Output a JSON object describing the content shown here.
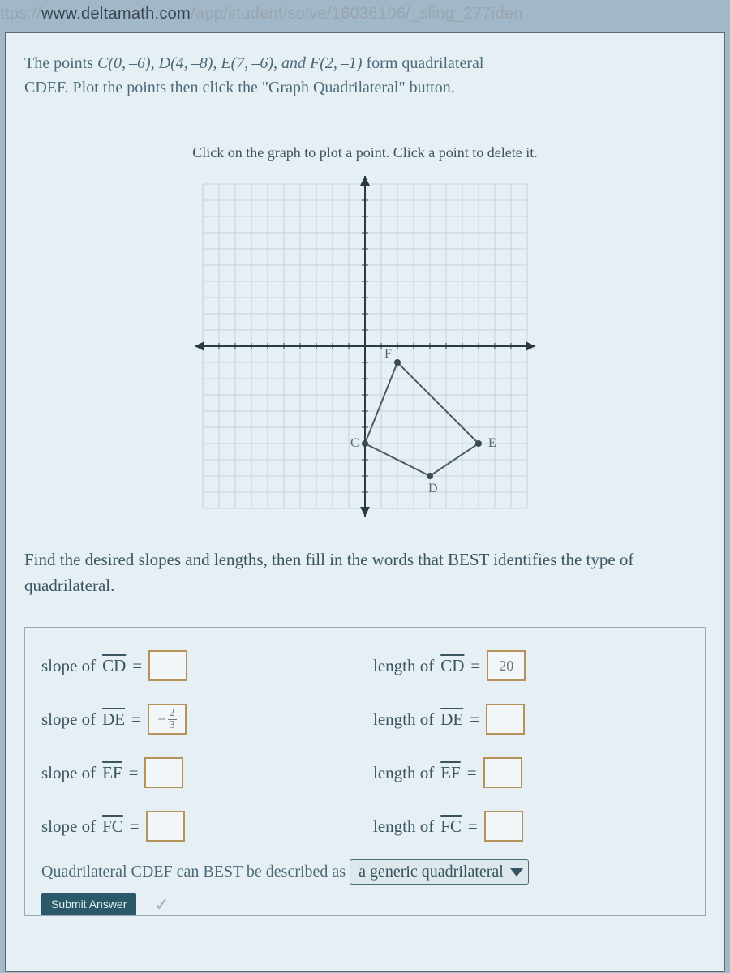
{
  "url": {
    "prefix": "ttps://",
    "host": "www.deltamath.com",
    "path": "/app/student/solve/16036106/_sling_277iden"
  },
  "problem": {
    "line1_pre": "The points ",
    "points": "C(0, –6), D(4, –8), E(7, –6), and F(2, –1)",
    "line1_post": " form quadrilateral",
    "line2": "CDEF. Plot the points then click the \"Graph Quadrilateral\" button."
  },
  "graph_instruction": "Click on the graph to plot a point. Click a point to delete it.",
  "graph_labels": {
    "C": "C",
    "D": "D",
    "E": "E",
    "F": "F"
  },
  "mid_text": "Find the desired slopes and lengths, then fill in the words that BEST identifies the type of quadrilateral.",
  "answers": {
    "slope_CD_label_a": "slope of ",
    "slope_DE_label_a": "slope of ",
    "slope_EF_label_a": "slope of ",
    "slope_FC_label_a": "slope of ",
    "length_CD_label_a": "length of ",
    "length_DE_label_a": "length of ",
    "length_EF_label_a": "length of ",
    "length_FC_label_a": "length of ",
    "seg_CD": "CD",
    "seg_DE": "DE",
    "seg_EF": "EF",
    "seg_FC": "FC",
    "eq": " = ",
    "slope_CD_val": "",
    "slope_DE_neg": "−",
    "slope_DE_num": "2",
    "slope_DE_den": "3",
    "slope_EF_val": "",
    "slope_FC_val": "",
    "length_CD_val": "20",
    "length_DE_val": "",
    "length_EF_val": "",
    "length_FC_val": ""
  },
  "conclusion": {
    "pre": "Quadrilateral CDEF can BEST be described as ",
    "selected": "a generic quadrilateral"
  },
  "submit_label": "Submit Answer"
}
